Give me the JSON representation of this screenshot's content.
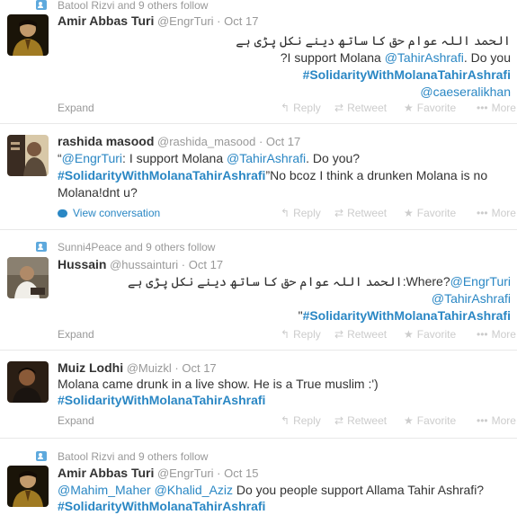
{
  "action_labels": {
    "reply": "Reply",
    "retweet": "Retweet",
    "favorite": "Favorite",
    "more": "More"
  },
  "expand_label": "Expand",
  "view_conversation_label": "View conversation",
  "tweets": [
    {
      "context": "Batool Rizvi and 9 others follow",
      "name": "Amir Abbas Turi",
      "handle": "@EngrTuri",
      "date": "Oct 17",
      "text": {
        "urdu": "الحمد اللہ عوام حق کا ساتھ دینے نکل پڑی ہے",
        "l2a": "?I support Molana ",
        "l2b": "@TahirAshrafi",
        "l2c": ". Do you",
        "l3": "#SolidarityWithMolanaTahirAshrafi",
        "l4": "@caeseralikhan"
      }
    },
    {
      "name": "rashida masood",
      "handle": "@rashida_masood",
      "date": "Oct 17",
      "text": {
        "l1a": "“",
        "l1b": "@EngrTuri",
        "l1c": ": I support Molana ",
        "l1d": "@TahirAshrafi",
        "l1e": ". Do you?",
        "l2a": "#SolidarityWithMolanaTahirAshrafi",
        "l2b": "”No bcoz I think a drunken Molana  is no",
        "l3": "Molana!dnt u?"
      }
    },
    {
      "context": "Sunni4Peace and 9 others follow",
      "name": "Hussain",
      "handle": "@hussainturi",
      "date": "Oct 17",
      "text": {
        "urdu": "الحمد اللہ عوام حق کا ساتھ دینے نکل پڑی ہے",
        "l1mid": ":Where?",
        "l1link": "@EngrTuri",
        "l2": "@TahirAshrafi",
        "l3a": "\"",
        "l3b": "#SolidarityWithMolanaTahirAshrafi"
      }
    },
    {
      "name": "Muiz Lodhi",
      "handle": "@Muizkl",
      "date": "Oct 17",
      "text": {
        "l1": "Molana came drunk in a live show. He is a True muslim :')",
        "l2": "#SolidarityWithMolanaTahirAshrafi"
      }
    },
    {
      "context": "Batool Rizvi and 9 others follow",
      "name": "Amir Abbas Turi",
      "handle": "@EngrTuri",
      "date": "Oct 15",
      "text": {
        "l1a": "@Mahim_Maher",
        "l1b": "@Khalid_Aziz",
        "l1c": " Do you people support Allama Tahir Ashrafi?",
        "l2": "#SolidarityWithMolanaTahirAshrafi"
      }
    }
  ]
}
